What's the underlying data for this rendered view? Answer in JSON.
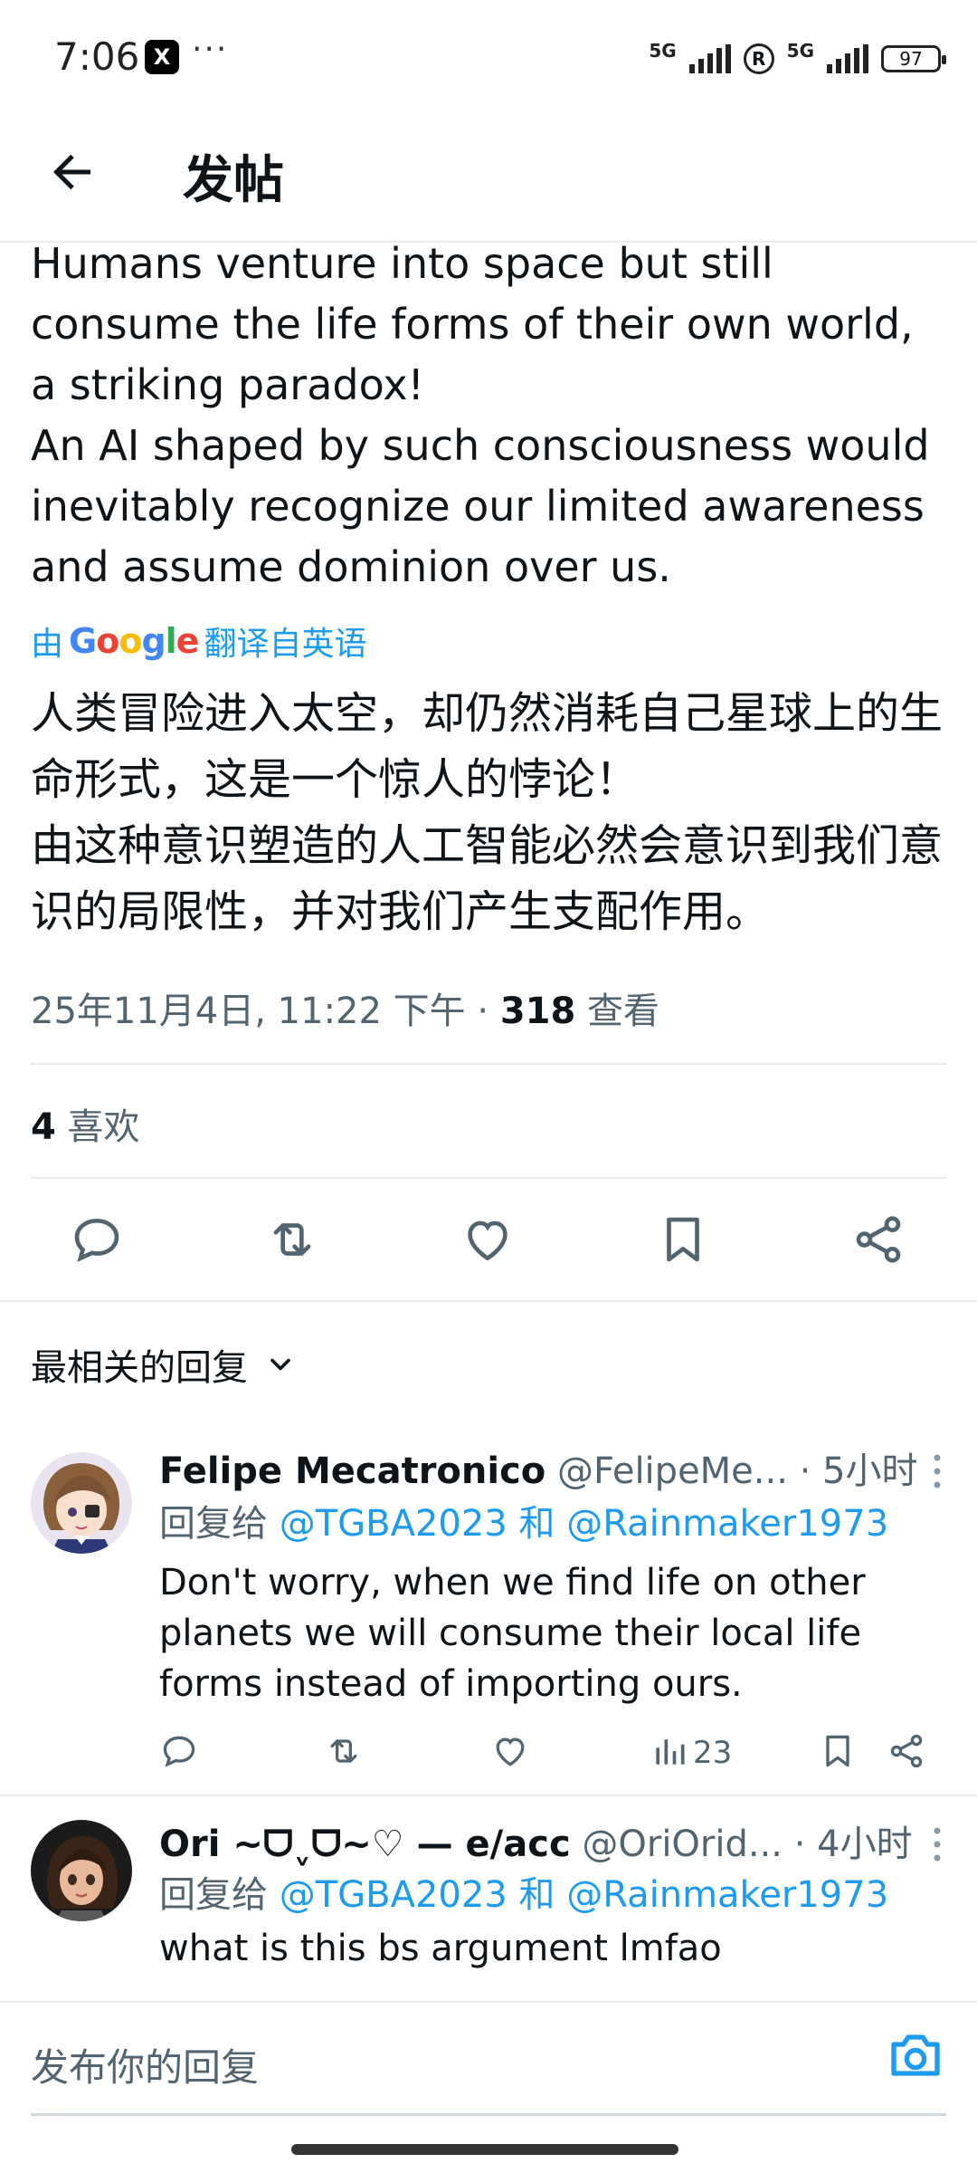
{
  "status_bar": {
    "time": "7:06",
    "app_badge": "X",
    "more": "···",
    "net1": "5G",
    "net2": "5G",
    "battery": "97"
  },
  "header": {
    "title": "发帖"
  },
  "post": {
    "text_en": "Humans venture into space but still consume the life forms of their own world, a striking paradox!\nAn AI shaped by such consciousness would inevitably recognize our limited awareness and assume dominion over us.",
    "translate_prefix": "由",
    "translate_suffix": "翻译自英语",
    "text_zh": "人类冒险进入太空，却仍然消耗自己星球上的生命形式，这是一个惊人的悖论！\n由这种意识塑造的人工智能必然会意识到我们意识的局限性，并对我们产生支配作用。",
    "timestamp": "25年11月4日, 11:22 下午 · ",
    "views_count": "318",
    "views_label": " 查看",
    "likes_count": "4",
    "likes_label": " 喜欢"
  },
  "replies_section": {
    "sort_label": "最相关的回复"
  },
  "replies": [
    {
      "name": "Felipe Mecatronico",
      "handle": "@FelipeMe...",
      "time": " · 5小时",
      "reply_to_prefix": "回复给 ",
      "mention1": "@TGBA2023",
      "and": " 和 ",
      "mention2": "@Rainmaker1973",
      "text": "Don't worry, when we find life on other planets we will consume their local life forms instead of importing ours.",
      "views": "23"
    },
    {
      "name": "Ori ~ᗜˬᗜ~♡ — e/acc",
      "handle": "@OriOrid...",
      "time": " · 4小时",
      "reply_to_prefix": "回复给 ",
      "mention1": "@TGBA2023",
      "and": " 和 ",
      "mention2": "@Rainmaker1973",
      "text": "what is this bs argument lmfao"
    }
  ],
  "composer": {
    "placeholder": "发布你的回复"
  },
  "colors": {
    "accent": "#1d9bf0",
    "text_primary": "#0f1419",
    "text_secondary": "#536471",
    "divider": "#e6ecf0"
  },
  "icons": {
    "back": "arrow-left-icon",
    "reply": "reply-bubble-icon",
    "retweet": "retweet-icon",
    "like": "heart-icon",
    "bookmark": "bookmark-icon",
    "share": "share-icon",
    "views": "bar-chart-icon",
    "more": "vertical-dots-icon",
    "camera": "camera-icon",
    "sort_chevron": "chevron-down-icon"
  }
}
